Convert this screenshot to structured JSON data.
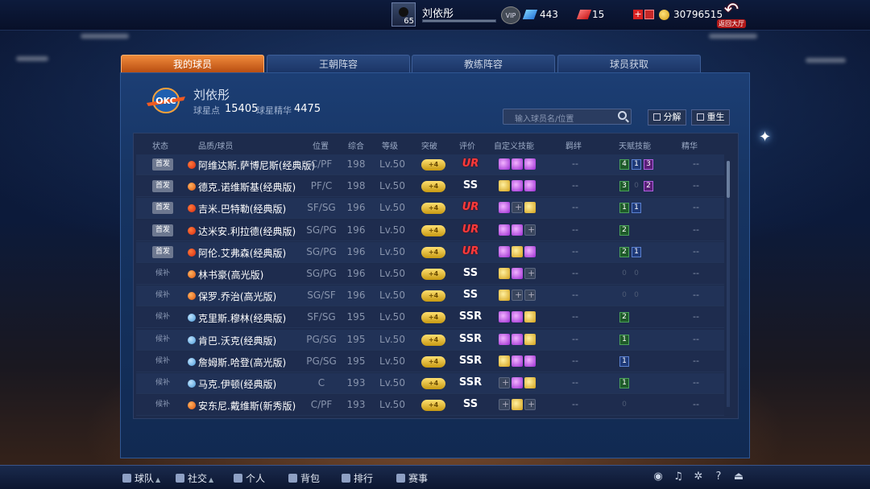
{
  "header": {
    "player_name": "刘依彤",
    "level": "65",
    "vip_label": "VIP",
    "diamonds": "443",
    "tickets": "15",
    "gold": "30796515",
    "back_label": "返回大厅"
  },
  "tabs": [
    {
      "label": "我的球员",
      "active": true
    },
    {
      "label": "王朝阵容",
      "active": false
    },
    {
      "label": "教练阵容",
      "active": false
    },
    {
      "label": "球员获取",
      "active": false
    }
  ],
  "team": {
    "logo_text": "OKC",
    "name": "刘依彤",
    "star_points_label": "球星点",
    "star_points": "15405",
    "essence_label": "球星精华",
    "essence": "4475"
  },
  "search": {
    "placeholder": "输入球员名/位置"
  },
  "actions": {
    "decompose": "分解",
    "rebirth": "重生"
  },
  "columns": [
    "状态",
    "品质/球员",
    "位置",
    "综合",
    "等级",
    "突破",
    "评价",
    "自定义技能",
    "羁绊",
    "天赋技能",
    "精华"
  ],
  "players": [
    {
      "status": "首发",
      "quality": "red",
      "name": "阿维达斯.萨博尼斯(经典版)",
      "pos": "C/PF",
      "ovr": "198",
      "lv": "Lv.50",
      "brk": "+4",
      "grade": "UR",
      "skills": [
        "purple",
        "purple",
        "purple"
      ],
      "bond": "--",
      "talents": [
        [
          "4",
          "g"
        ],
        [
          "1",
          "b"
        ],
        [
          "3",
          "p"
        ]
      ],
      "essence": "--"
    },
    {
      "status": "首发",
      "quality": "orange",
      "name": "德克.诺维斯基(经典版)",
      "pos": "PF/C",
      "ovr": "198",
      "lv": "Lv.50",
      "brk": "+4",
      "grade": "SS",
      "skills": [
        "gold",
        "purple",
        "purple"
      ],
      "bond": "--",
      "talents": [
        [
          "3",
          "g"
        ],
        [
          "0",
          "d"
        ],
        [
          "2",
          "p"
        ]
      ],
      "essence": "--"
    },
    {
      "status": "首发",
      "quality": "red",
      "name": "吉米.巴特勒(经典版)",
      "pos": "SF/SG",
      "ovr": "196",
      "lv": "Lv.50",
      "brk": "+4",
      "grade": "UR",
      "skills": [
        "purple",
        "empty",
        "gold"
      ],
      "bond": "--",
      "talents": [
        [
          "1",
          "g"
        ],
        [
          "1",
          "b"
        ]
      ],
      "essence": "--"
    },
    {
      "status": "首发",
      "quality": "red",
      "name": "达米安.利拉德(经典版)",
      "pos": "SG/PG",
      "ovr": "196",
      "lv": "Lv.50",
      "brk": "+4",
      "grade": "UR",
      "skills": [
        "purple",
        "purple",
        "empty"
      ],
      "bond": "--",
      "talents": [
        [
          "2",
          "g"
        ]
      ],
      "essence": "--"
    },
    {
      "status": "首发",
      "quality": "red",
      "name": "阿伦.艾弗森(经典版)",
      "pos": "SG/PG",
      "ovr": "196",
      "lv": "Lv.50",
      "brk": "+4",
      "grade": "UR",
      "skills": [
        "purple",
        "gold",
        "purple"
      ],
      "bond": "--",
      "talents": [
        [
          "2",
          "g"
        ],
        [
          "1",
          "b"
        ]
      ],
      "essence": "--"
    },
    {
      "status": "候补",
      "quality": "orange",
      "name": "林书豪(高光版)",
      "pos": "SG/PG",
      "ovr": "196",
      "lv": "Lv.50",
      "brk": "+4",
      "grade": "SS",
      "skills": [
        "gold",
        "purple",
        "empty"
      ],
      "bond": "--",
      "talents": [
        [
          "0",
          "d"
        ],
        [
          "0",
          "d"
        ]
      ],
      "essence": "--"
    },
    {
      "status": "候补",
      "quality": "orange",
      "name": "保罗.乔治(高光版)",
      "pos": "SG/SF",
      "ovr": "196",
      "lv": "Lv.50",
      "brk": "+4",
      "grade": "SS",
      "skills": [
        "gold",
        "empty",
        "empty"
      ],
      "bond": "--",
      "talents": [
        [
          "0",
          "d"
        ],
        [
          "0",
          "d"
        ]
      ],
      "essence": "--"
    },
    {
      "status": "候补",
      "quality": "blue",
      "name": "克里斯.穆林(经典版)",
      "pos": "SF/SG",
      "ovr": "195",
      "lv": "Lv.50",
      "brk": "+4",
      "grade": "SSR",
      "skills": [
        "purple",
        "purple",
        "gold"
      ],
      "bond": "--",
      "talents": [
        [
          "2",
          "g"
        ]
      ],
      "essence": "--"
    },
    {
      "status": "候补",
      "quality": "blue",
      "name": "肯巴.沃克(经典版)",
      "pos": "PG/SG",
      "ovr": "195",
      "lv": "Lv.50",
      "brk": "+4",
      "grade": "SSR",
      "skills": [
        "purple",
        "purple",
        "gold"
      ],
      "bond": "--",
      "talents": [
        [
          "1",
          "g"
        ]
      ],
      "essence": "--"
    },
    {
      "status": "候补",
      "quality": "blue",
      "name": "詹姆斯.哈登(高光版)",
      "pos": "PG/SG",
      "ovr": "195",
      "lv": "Lv.50",
      "brk": "+4",
      "grade": "SSR",
      "skills": [
        "gold",
        "purple",
        "purple"
      ],
      "bond": "--",
      "talents": [
        [
          "1",
          "b"
        ]
      ],
      "essence": "--"
    },
    {
      "status": "候补",
      "quality": "blue",
      "name": "马克.伊顿(经典版)",
      "pos": "C",
      "ovr": "193",
      "lv": "Lv.50",
      "brk": "+4",
      "grade": "SSR",
      "skills": [
        "empty",
        "purple",
        "gold"
      ],
      "bond": "--",
      "talents": [
        [
          "1",
          "g"
        ]
      ],
      "essence": "--"
    },
    {
      "status": "候补",
      "quality": "orange",
      "name": "安东尼.戴维斯(新秀版)",
      "pos": "C/PF",
      "ovr": "193",
      "lv": "Lv.50",
      "brk": "+4",
      "grade": "SS",
      "skills": [
        "empty",
        "gold",
        "empty"
      ],
      "bond": "--",
      "talents": [
        [
          "0",
          "d"
        ]
      ],
      "essence": "--"
    }
  ],
  "bottom_nav": [
    {
      "label": "球队",
      "caret": true
    },
    {
      "label": "社交",
      "caret": true
    },
    {
      "label": "个人",
      "caret": false
    },
    {
      "label": "背包",
      "caret": false
    },
    {
      "label": "排行",
      "caret": false
    },
    {
      "label": "赛事",
      "caret": false
    }
  ],
  "colors": {
    "accent_tab": "#f08a3a",
    "panel": "#163462",
    "grade_ur": "#ff3a3a",
    "gold": "#d3a018"
  }
}
